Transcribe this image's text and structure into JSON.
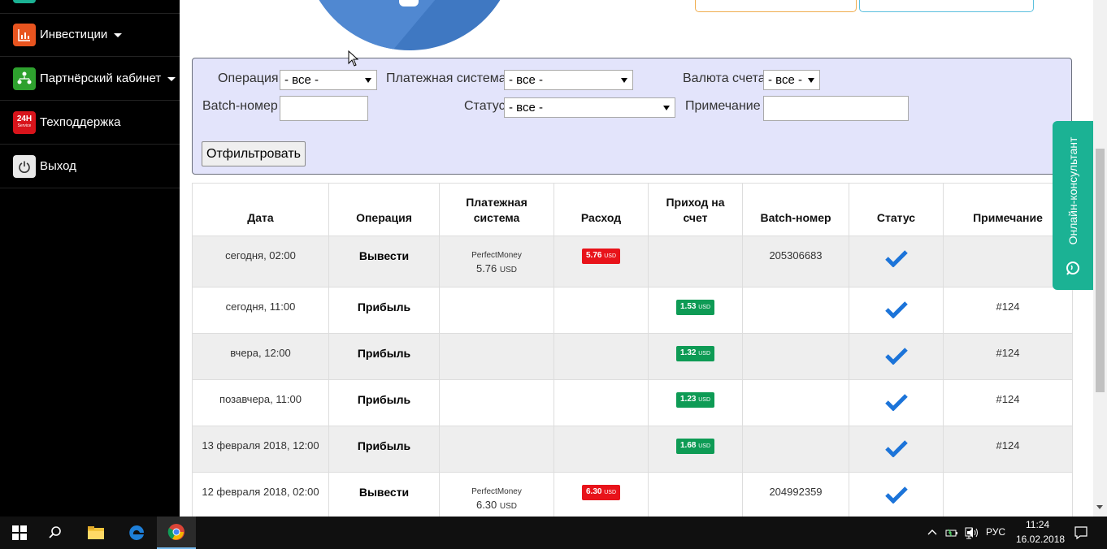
{
  "sidebar": {
    "items": [
      {
        "label": "Инвестиции",
        "icon": "chart-icon",
        "has_dropdown": true
      },
      {
        "label": "Партнёрский кабинет",
        "icon": "partners-icon",
        "has_dropdown": true
      },
      {
        "label": "Техподдержка",
        "icon": "support-24h-icon",
        "has_dropdown": false
      },
      {
        "label": "Выход",
        "icon": "power-icon",
        "has_dropdown": false
      }
    ],
    "support_icon_text": "24H",
    "support_icon_subtext": "Service"
  },
  "filter": {
    "operation_label": "Операция",
    "operation_value": "- все -",
    "payment_system_label": "Платежная система",
    "payment_system_value": "- все -",
    "currency_label": "Валюта счета",
    "currency_value": "- все -",
    "batch_label": "Batch-номер",
    "batch_value": "",
    "status_label": "Статус",
    "status_value": "- все -",
    "note_label": "Примечание",
    "note_value": "",
    "submit_label": "Отфильтровать"
  },
  "table": {
    "headers": [
      "Дата",
      "Операция",
      "Платежная система",
      "Расход",
      "Приход на счет",
      "Batch-номер",
      "Статус",
      "Примечание"
    ],
    "rows": [
      {
        "date": "сегодня, 02:00",
        "operation": "Вывести",
        "ps_name": "PerfectMoney",
        "ps_amount": "5.76",
        "ps_currency": "USD",
        "expense": "5.76",
        "expense_currency": "USD",
        "income": "",
        "income_currency": "",
        "batch": "205306683",
        "status": "check-icon",
        "note": ""
      },
      {
        "date": "сегодня, 11:00",
        "operation": "Прибыль",
        "ps_name": "",
        "ps_amount": "",
        "ps_currency": "",
        "expense": "",
        "expense_currency": "",
        "income": "1.53",
        "income_currency": "USD",
        "batch": "",
        "status": "check-icon",
        "note": "#124"
      },
      {
        "date": "вчера, 12:00",
        "operation": "Прибыль",
        "ps_name": "",
        "ps_amount": "",
        "ps_currency": "",
        "expense": "",
        "expense_currency": "",
        "income": "1.32",
        "income_currency": "USD",
        "batch": "",
        "status": "check-icon",
        "note": "#124"
      },
      {
        "date": "позавчера, 11:00",
        "operation": "Прибыль",
        "ps_name": "",
        "ps_amount": "",
        "ps_currency": "",
        "expense": "",
        "expense_currency": "",
        "income": "1.23",
        "income_currency": "USD",
        "batch": "",
        "status": "check-icon",
        "note": "#124"
      },
      {
        "date": "13 февраля 2018, 12:00",
        "operation": "Прибыль",
        "ps_name": "",
        "ps_amount": "",
        "ps_currency": "",
        "expense": "",
        "expense_currency": "",
        "income": "1.68",
        "income_currency": "USD",
        "batch": "",
        "status": "check-icon",
        "note": "#124"
      },
      {
        "date": "12 февраля 2018, 02:00",
        "operation": "Вывести",
        "ps_name": "PerfectMoney",
        "ps_amount": "6.30",
        "ps_currency": "USD",
        "expense": "6.30",
        "expense_currency": "USD",
        "income": "",
        "income_currency": "",
        "batch": "204992359",
        "status": "check-icon",
        "note": ""
      }
    ]
  },
  "consultant": {
    "label": "Онлайн-консультант"
  },
  "taskbar": {
    "language": "РУС",
    "time": "11:24",
    "date": "16.02.2018"
  },
  "colors": {
    "expense_badge": "#e8131a",
    "income_badge": "#0e9b55",
    "check": "#1c74d9",
    "filter_bg": "#e3e4fb",
    "consultant_bg": "#1bb294"
  }
}
